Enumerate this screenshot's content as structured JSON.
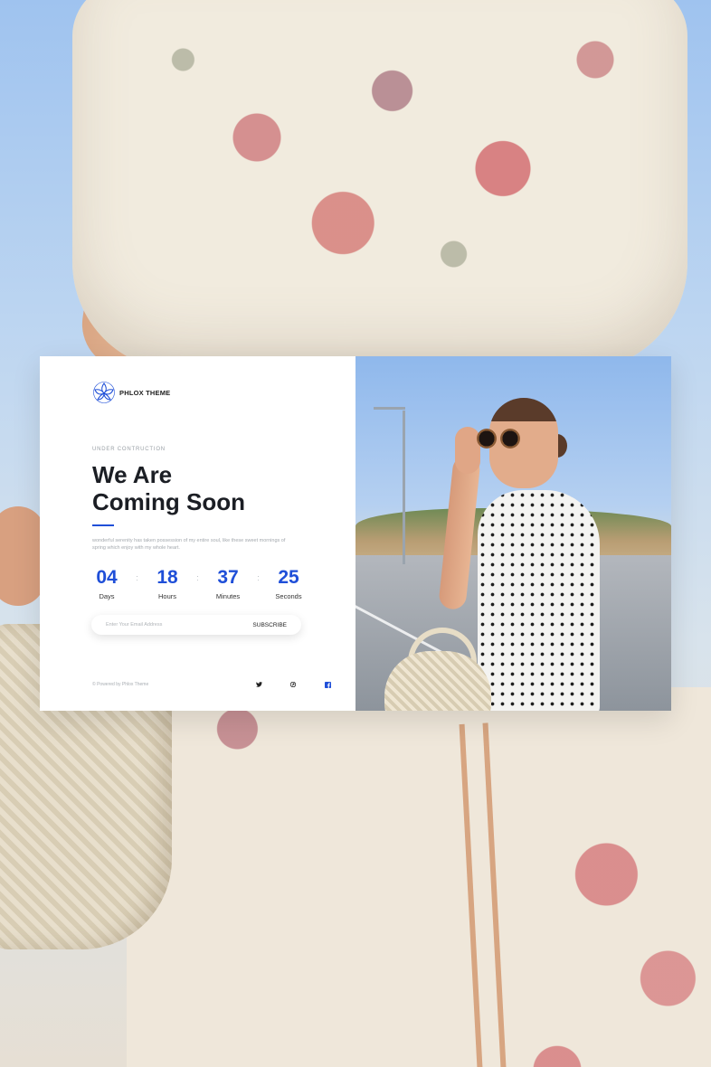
{
  "brand": {
    "name": "PHLOX THEME",
    "accent_color": "#1f4fd8",
    "logo_icon": "lotus-logo-icon"
  },
  "hero": {
    "eyebrow": "UNDER CONTRUCTION",
    "title_line1": "We Are",
    "title_line2": "Coming Soon",
    "description": "wonderful serenity has taken possession of my entire soul, like these sweet mornings of spring which enjoy with my whole heart."
  },
  "countdown": {
    "units": [
      {
        "value": "04",
        "label": "Days"
      },
      {
        "value": "18",
        "label": "Hours"
      },
      {
        "value": "37",
        "label": "Minutes"
      },
      {
        "value": "25",
        "label": "Seconds"
      }
    ],
    "separator": ":"
  },
  "subscribe": {
    "placeholder": "Enter Your Email Address",
    "button_label": "SUBSCRIBE"
  },
  "footer": {
    "copyright": "© Powered by Phlox Theme",
    "social": [
      {
        "name": "twitter-icon"
      },
      {
        "name": "pinterest-icon"
      },
      {
        "name": "facebook-icon"
      }
    ]
  }
}
